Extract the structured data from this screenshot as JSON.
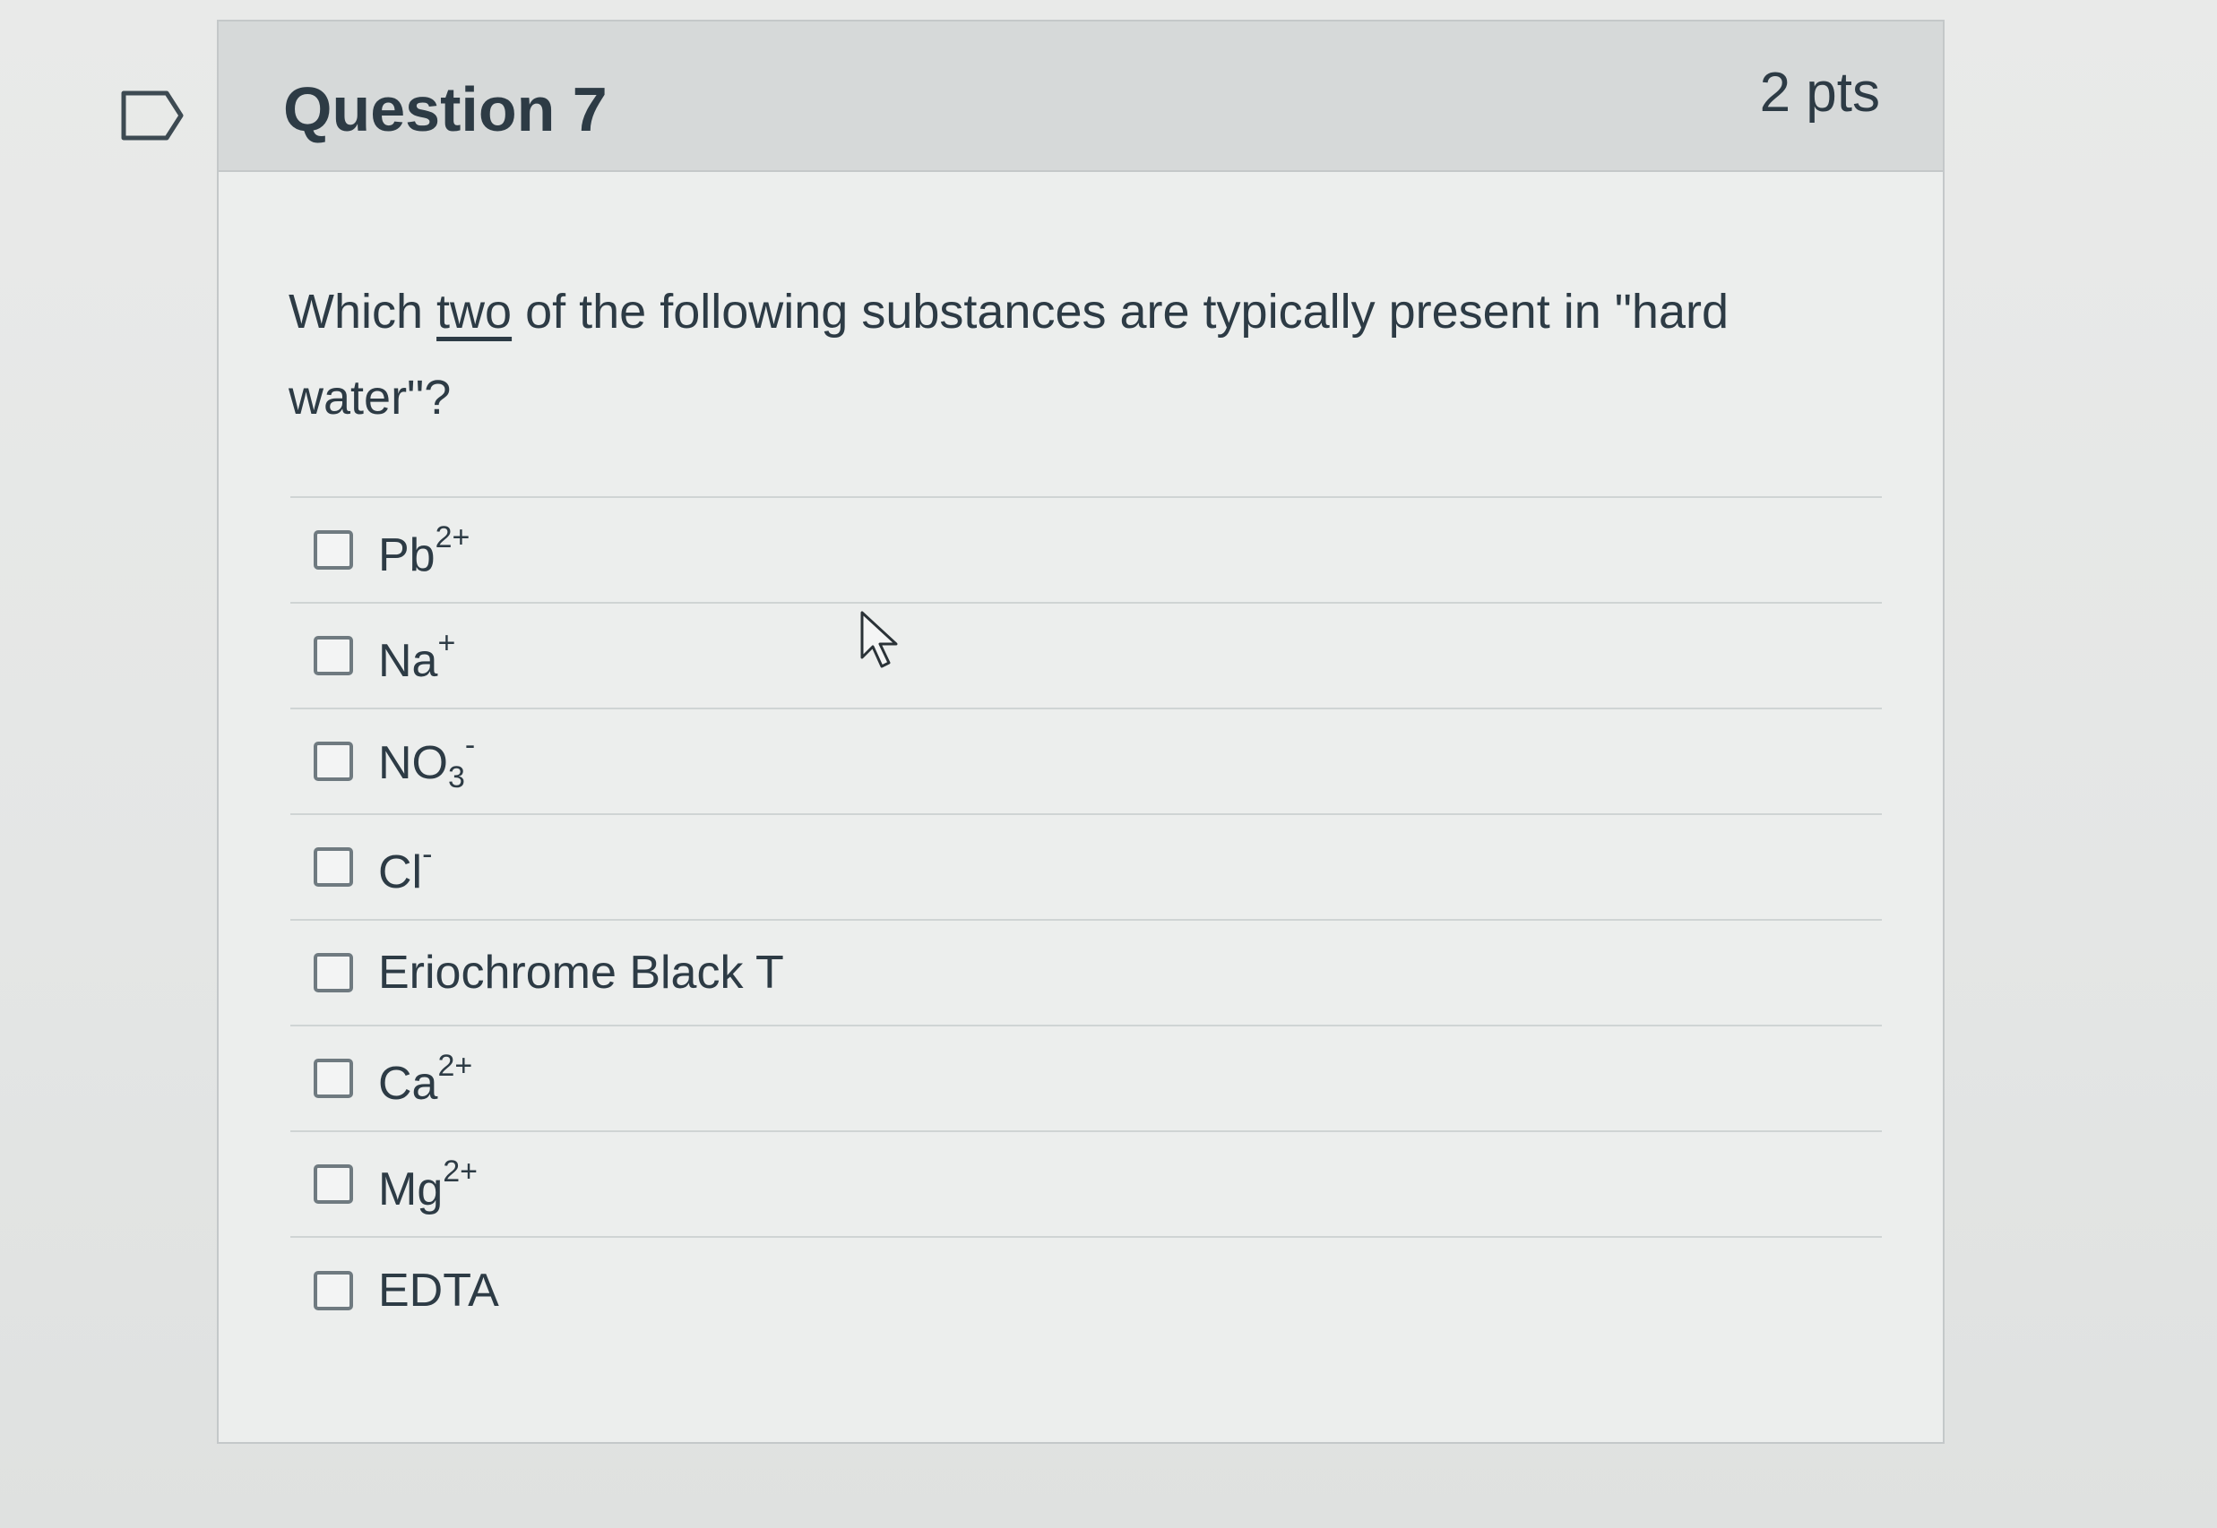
{
  "question": {
    "title": "Question 7",
    "points": "2 pts",
    "text_before": "Which ",
    "text_underlined": "two",
    "text_after": " of the following substances are typically present in \"hard water\"?"
  },
  "answers": [
    {
      "base": "Pb",
      "sup": "2+",
      "sub": ""
    },
    {
      "base": "Na",
      "sup": "+",
      "sub": ""
    },
    {
      "base": "NO",
      "sup": "-",
      "sub": "3"
    },
    {
      "base": "Cl",
      "sup": "-",
      "sub": ""
    },
    {
      "base": "Eriochrome Black T",
      "sup": "",
      "sub": ""
    },
    {
      "base": "Ca",
      "sup": "2+",
      "sub": ""
    },
    {
      "base": "Mg",
      "sup": "2+",
      "sub": ""
    },
    {
      "base": "EDTA",
      "sup": "",
      "sub": ""
    }
  ],
  "icons": {
    "flag": "bookmark-flag-icon",
    "cursor": "mouse-pointer-icon"
  },
  "colors": {
    "text": "#2d3b45",
    "header_bg": "#d6d9d9",
    "border": "#c4c8c9"
  }
}
